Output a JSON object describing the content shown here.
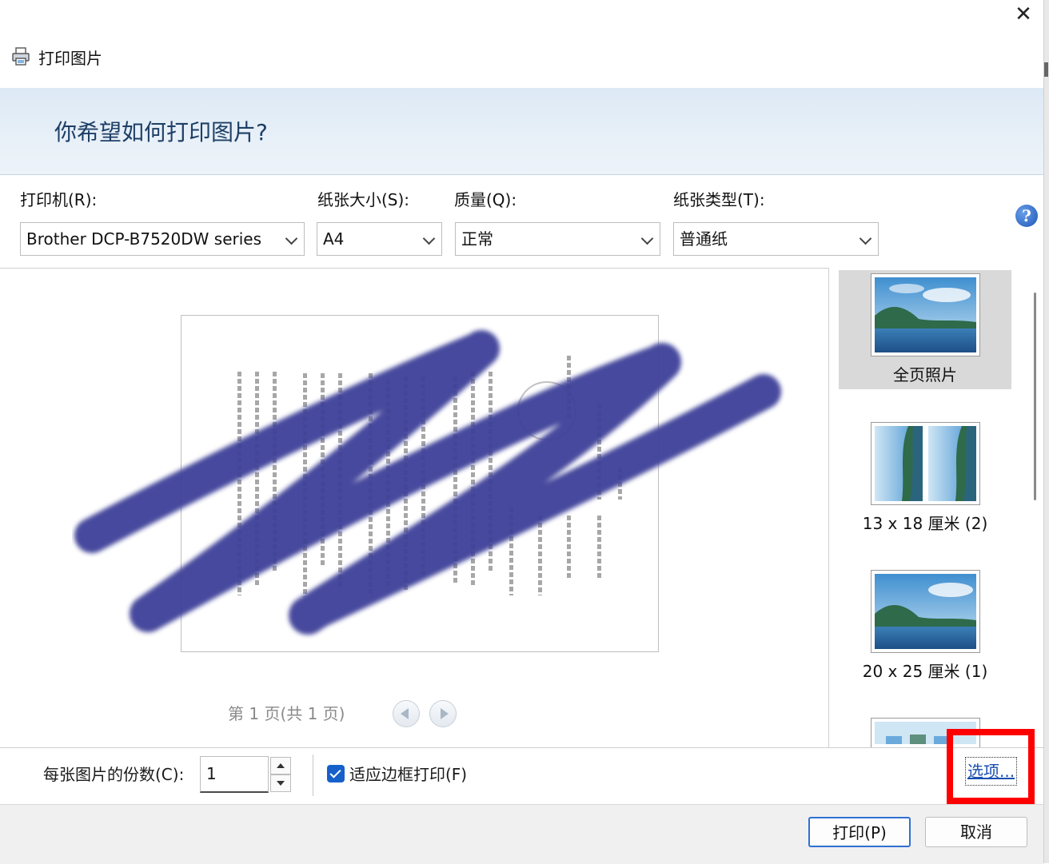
{
  "window": {
    "title": "打印图片",
    "close_icon": "close-icon"
  },
  "banner": {
    "heading": "你希望如何打印图片?"
  },
  "settings": {
    "printer": {
      "label": "打印机(R):",
      "value": "Brother DCP-B7520DW series"
    },
    "paper_size": {
      "label": "纸张大小(S):",
      "value": "A4"
    },
    "quality": {
      "label": "质量(Q):",
      "value": "正常"
    },
    "paper_type": {
      "label": "纸张类型(T):",
      "value": "普通纸"
    },
    "help_icon": "?"
  },
  "preview": {
    "page_info": "第 1 页(共 1 页)"
  },
  "layouts": [
    {
      "label": "全页照片",
      "selected": true
    },
    {
      "label": "13 x 18 厘米 (2)",
      "selected": false
    },
    {
      "label": "20 x 25 厘米 (1)",
      "selected": false
    },
    {
      "label": "",
      "selected": false
    }
  ],
  "bottom": {
    "copies_label": "每张图片的份数(C):",
    "copies_value": "1",
    "fit_checked": true,
    "fit_label": "适应边框打印(F)",
    "options_link": "选项..."
  },
  "buttons": {
    "print": "打印(P)",
    "cancel": "取消"
  },
  "colors": {
    "accent": "#1560c9",
    "highlight": "#ff0000",
    "scribble": "#3c3f98"
  }
}
